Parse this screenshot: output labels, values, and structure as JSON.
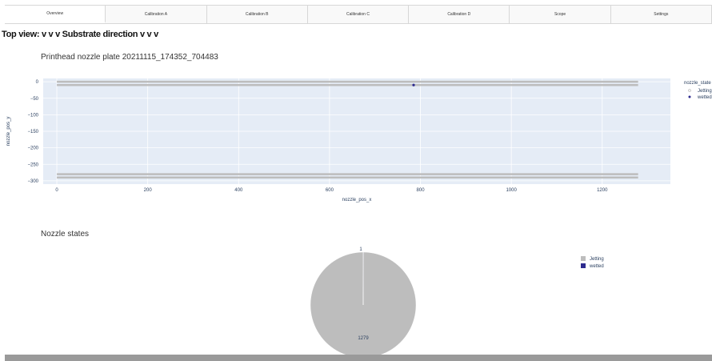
{
  "tabs": [
    "Overview",
    "Calibration A",
    "Calibration B",
    "Calibration C",
    "Calibration D",
    "Scope",
    "Settings"
  ],
  "top_view_text": "Top view: v v v Substrate direction v v v",
  "colors": {
    "plot_bg": "#e5ecf6",
    "jetting": "#bdbdbd",
    "wetted": "#2e2b8f",
    "grid": "#ffffff"
  },
  "chart_data": [
    {
      "type": "scatter",
      "title": "Printhead nozzle plate 20211115_174352_704483",
      "xlabel": "nozzle_pos_x",
      "ylabel": "nozzle_pos_y",
      "xlim": [
        -30,
        1350
      ],
      "ylim": [
        -310,
        10
      ],
      "x_ticks": [
        "0",
        "200",
        "400",
        "600",
        "800",
        "1000",
        "1200"
      ],
      "y_ticks": [
        "0",
        "−50",
        "−100",
        "−150",
        "−200",
        "−250",
        "−300"
      ],
      "legend_title": "nozzle_state",
      "series": [
        {
          "name": "Jetting",
          "rows_y": [
            0,
            -10,
            -280,
            -290
          ],
          "x_range": [
            0,
            1279
          ]
        },
        {
          "name": "wetted",
          "points": [
            [
              785,
              -10
            ]
          ]
        }
      ]
    },
    {
      "type": "pie",
      "title": "Nozzle states",
      "labels": [
        "Jetting",
        "wetted"
      ],
      "values": [
        1279,
        1
      ],
      "value_labels": [
        "1279",
        "1"
      ]
    }
  ]
}
